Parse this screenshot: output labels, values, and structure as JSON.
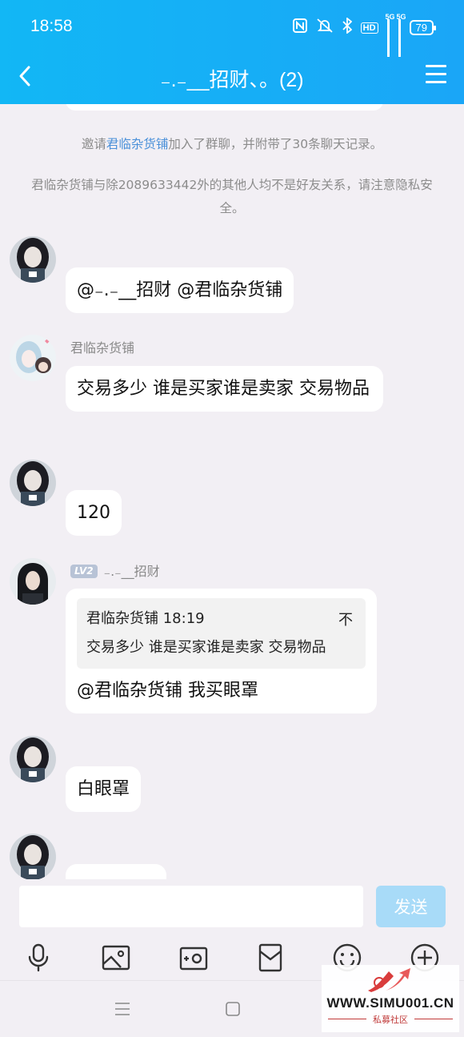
{
  "status": {
    "time": "18:58",
    "battery": "79",
    "hd": "HD",
    "net1": "5G",
    "net2": "5G"
  },
  "header": {
    "title": "₋.₋__招财、。(2)"
  },
  "system": {
    "msg1_link": "君临杂货铺",
    "msg1_text": "加入了群聊，并附带了30条聊天记录。",
    "msg1_prefix": "邀请",
    "msg2": "君临杂货铺与除2089633442外的其他人均不是好友关系，请注意隐私安全。"
  },
  "messages": {
    "m1": "@₋.₋__招财 @君临杂货铺",
    "m2_nick": "君临杂货铺",
    "m2": "交易多少 谁是买家谁是卖家 交易物品",
    "m3": "120",
    "m4_level": "LV2",
    "m4_nick": "₋.₋__招财",
    "m4_quote_head": "君临杂货铺 18:19",
    "m4_quote_arrow": "不",
    "m4_quote_body": "交易多少 谁是买家谁是卖家 交易物品",
    "m4": "@君临杂货铺 我买眼罩",
    "m5": "白眼罩"
  },
  "input": {
    "placeholder": "",
    "send_label": "发送"
  },
  "toolbar": {
    "icons": [
      "microphone-icon",
      "image-icon",
      "camera-icon",
      "red-packet-icon",
      "emoji-icon",
      "plus-icon"
    ]
  },
  "watermark": {
    "site": "WWW.SIMU001.CN",
    "sub": "私募社区"
  },
  "colors": {
    "header": "#12b7f5",
    "link": "#4a90d9",
    "send_disabled": "#a8dbf8",
    "background": "#f2eff4"
  }
}
